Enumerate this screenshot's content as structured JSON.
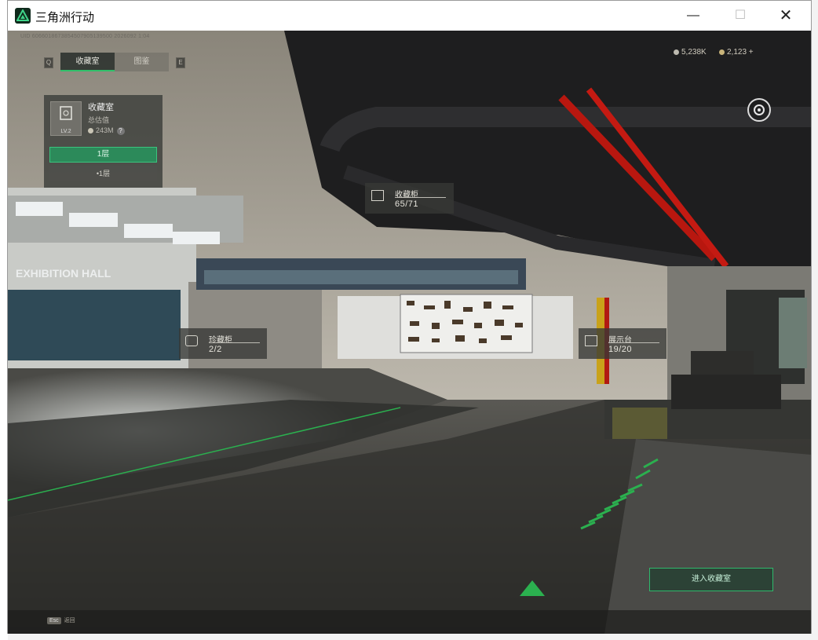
{
  "window": {
    "title": "三角洲行动",
    "minimize": "—",
    "maximize": "☐",
    "close": "✕"
  },
  "uid": "UID 6066018673854507905139500 2026092 1:04",
  "tabs": {
    "left_arrow": "Q",
    "right_arrow": "E",
    "active": "收藏室",
    "inactive": "图鉴"
  },
  "panel": {
    "name": "收藏室",
    "sub": "总估值",
    "value": "243M",
    "help": "?",
    "level": "LV.2",
    "button_primary": "1层",
    "button_secondary": "•1层"
  },
  "currency": {
    "coins": "5,238K",
    "tickets": "2,123 +"
  },
  "hall_sign": "EXHIBITION HALL",
  "tags": [
    {
      "name": "收藏柜",
      "count": "65/71"
    },
    {
      "name": "珍藏柜",
      "count": "2/2"
    },
    {
      "name": "展示台",
      "count": "19/20"
    }
  ],
  "enter_button": "进入收藏室",
  "esc": {
    "key": "Esc",
    "label": "返回"
  },
  "colors": {
    "accent": "#30c06a",
    "pipe_red": "#c41a12"
  }
}
